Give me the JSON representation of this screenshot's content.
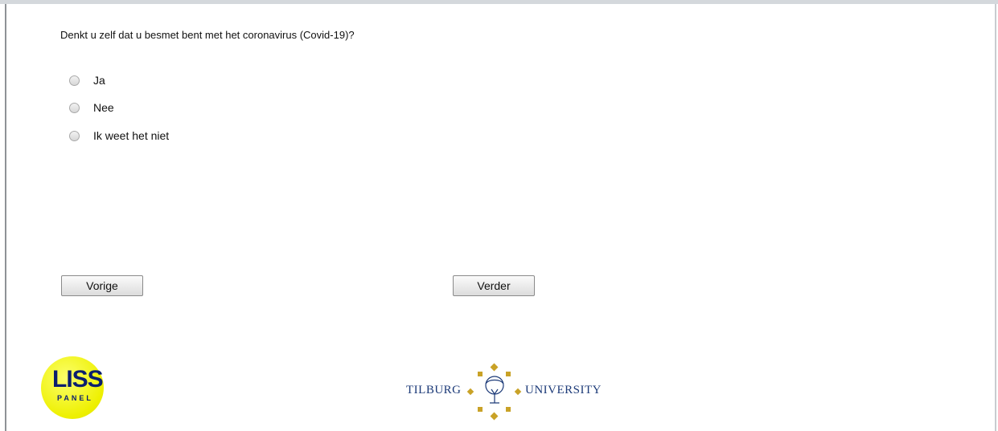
{
  "survey": {
    "question": "Denkt u zelf dat u besmet bent met het coronavirus (Covid-19)?",
    "options": [
      {
        "label": "Ja",
        "selected": false
      },
      {
        "label": "Nee",
        "selected": false
      },
      {
        "label": "Ik weet het niet",
        "selected": false
      }
    ]
  },
  "navigation": {
    "previous_label": "Vorige",
    "next_label": "Verder"
  },
  "footer": {
    "liss_logo": {
      "main": "LISS",
      "sub": "PANEL"
    },
    "tilburg_logo": {
      "left": "TILBURG",
      "right": "UNIVERSITY"
    }
  },
  "colors": {
    "liss_yellow": "#eef000",
    "liss_navy": "#0b1e6e",
    "tilburg_gold": "#c9a227",
    "tilburg_blue": "#1c3a78"
  }
}
